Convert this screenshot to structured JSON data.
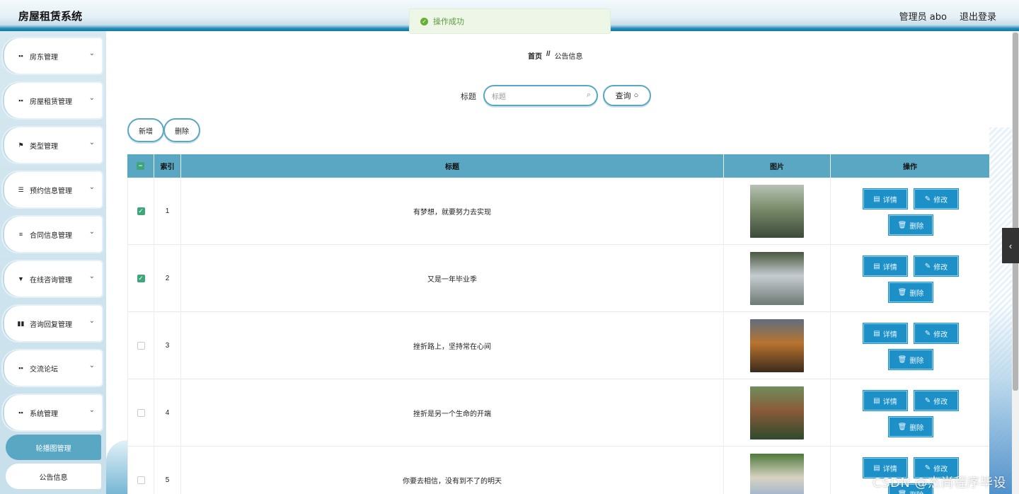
{
  "header": {
    "app_title": "房屋租赁系统",
    "user_label": "管理员 abo",
    "logout_label": "退出登录"
  },
  "toast": {
    "message": "操作成功",
    "color": "#67b035"
  },
  "sidebar": {
    "items": [
      {
        "label": "房东管理",
        "icon": "grid-icon"
      },
      {
        "label": "房屋租赁管理",
        "icon": "grid-icon"
      },
      {
        "label": "类型管理",
        "icon": "flag-icon"
      },
      {
        "label": "预约信息管理",
        "icon": "sliders-icon"
      },
      {
        "label": "合同信息管理",
        "icon": "list-icon"
      },
      {
        "label": "在线咨询管理",
        "icon": "pin-icon"
      },
      {
        "label": "咨询回复管理",
        "icon": "chart-icon"
      },
      {
        "label": "交流论坛",
        "icon": "grid-icon"
      },
      {
        "label": "系统管理",
        "icon": "grid-icon"
      }
    ],
    "sub_items": [
      {
        "label": "轮播图管理",
        "active": true
      },
      {
        "label": "公告信息",
        "active": false
      }
    ]
  },
  "breadcrumb": {
    "home": "首页",
    "separator": "//",
    "current": "公告信息"
  },
  "search": {
    "label": "标题",
    "placeholder": "标题",
    "query_label": "查询"
  },
  "actions": {
    "add_label": "新增",
    "delete_label": "删除"
  },
  "table": {
    "headers": {
      "index": "索引",
      "title": "标题",
      "image": "图片",
      "ops": "操作"
    },
    "rows": [
      {
        "index": "1",
        "title": "有梦想，就要努力去实现",
        "checked": true
      },
      {
        "index": "2",
        "title": "又是一年毕业季",
        "checked": true
      },
      {
        "index": "3",
        "title": "挫折路上，坚持常在心间",
        "checked": false
      },
      {
        "index": "4",
        "title": "挫折是另一个生命的开端",
        "checked": false
      },
      {
        "index": "5",
        "title": "你要去相信，没有到不了的明天",
        "checked": false
      }
    ],
    "op_labels": {
      "detail": "详情",
      "edit": "修改",
      "delete": "删除"
    }
  },
  "watermark": "CSDN @杰尚程序毕设",
  "colors": {
    "accent": "#5aa7c3",
    "op_button": "#1e90c8",
    "checkbox": "#3ea67a"
  }
}
